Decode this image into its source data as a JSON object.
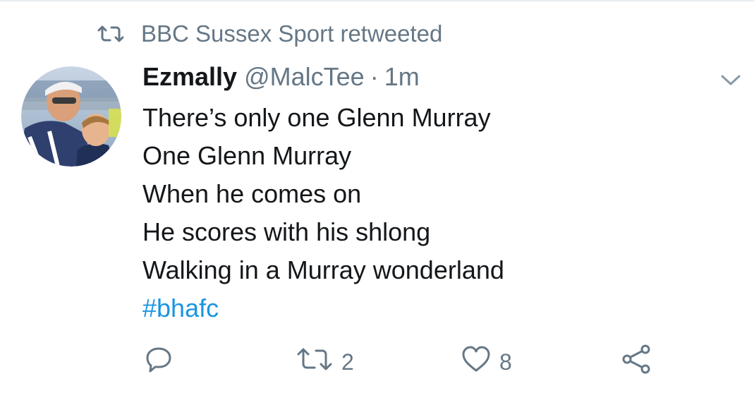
{
  "colors": {
    "text": "#14171a",
    "secondary": "#657786",
    "link": "#1b95e0",
    "divider": "#e6ecf0"
  },
  "retweet_context": {
    "icon": "retweet-icon",
    "text": "BBC Sussex Sport retweeted"
  },
  "tweet": {
    "avatar": "avatar-image",
    "display_name": "Ezmally",
    "handle": "@MalcTee",
    "separator": "·",
    "timestamp": "1m",
    "text_lines": [
      "There’s only one Glenn Murray",
      "One Glenn Murray",
      "When he comes on",
      "He scores with his shlong",
      "Walking in a Murray wonderland"
    ],
    "hashtag": "#bhafc",
    "menu_icon": "chevron-down-icon"
  },
  "actions": {
    "reply": {
      "icon": "reply-icon"
    },
    "retweet": {
      "icon": "retweet-icon",
      "count": "2"
    },
    "like": {
      "icon": "heart-icon",
      "count": "8"
    },
    "share": {
      "icon": "share-icon"
    }
  }
}
